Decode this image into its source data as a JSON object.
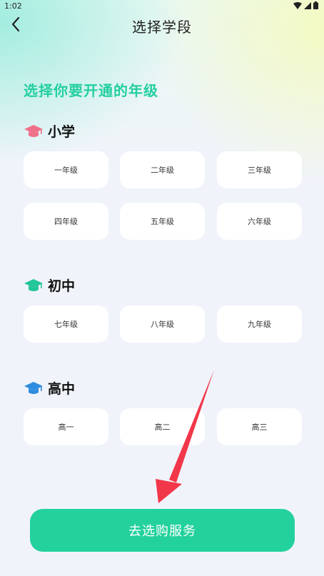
{
  "status_bar": {
    "time": "1:02"
  },
  "header": {
    "title": "选择学段"
  },
  "heading": "选择你要开通的年级",
  "sections": [
    {
      "title": "小学",
      "icon_color": "#f0708a",
      "grades": [
        "一年级",
        "二年级",
        "三年级",
        "四年级",
        "五年级",
        "六年级"
      ]
    },
    {
      "title": "初中",
      "icon_color": "#23c59a",
      "grades": [
        "七年级",
        "八年级",
        "九年级"
      ]
    },
    {
      "title": "高中",
      "icon_color": "#2f8de0",
      "grades": [
        "高一",
        "高二",
        "高三"
      ]
    }
  ],
  "cta": {
    "label": "去选购服务"
  },
  "colors": {
    "accent": "#23d19c",
    "heading": "#23cfa0",
    "arrow": "#f2374a"
  },
  "icons": [
    "back-chevron-icon",
    "wifi-icon",
    "signal-icon",
    "battery-icon",
    "graduation-cap-icon",
    "red-arrow-annotation"
  ]
}
